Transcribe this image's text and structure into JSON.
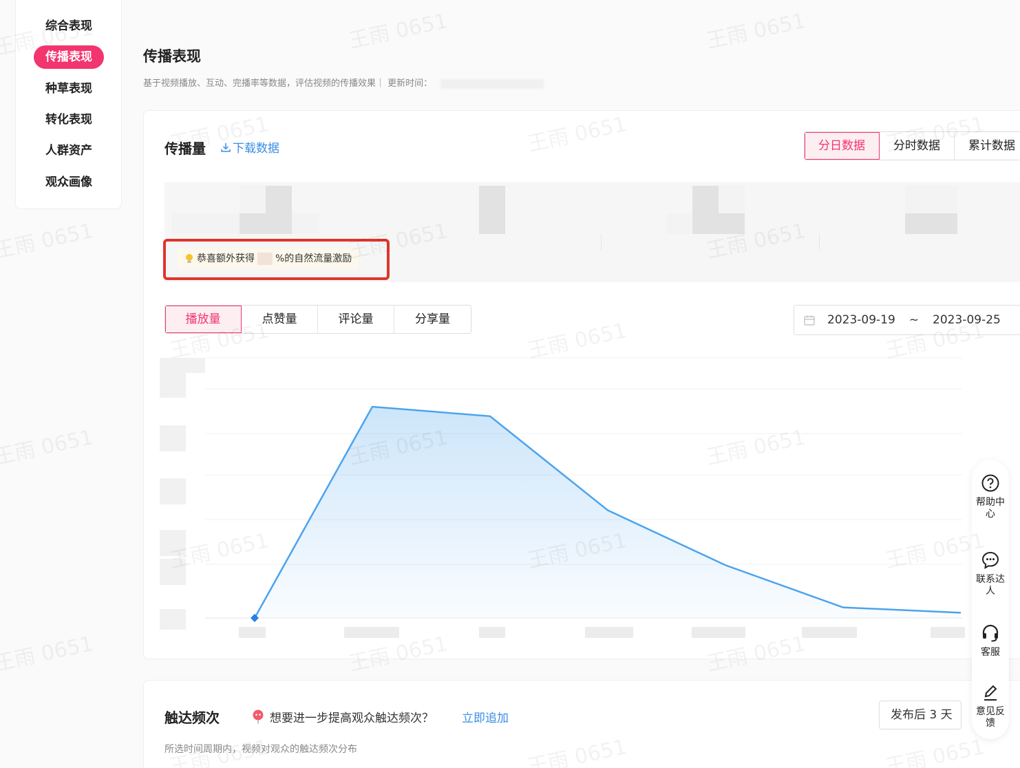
{
  "sidebar": {
    "items": [
      {
        "label": "综合表现",
        "active": false
      },
      {
        "label": "传播表现",
        "active": true
      },
      {
        "label": "种草表现",
        "active": false
      },
      {
        "label": "转化表现",
        "active": false
      },
      {
        "label": "人群资产",
        "active": false
      },
      {
        "label": "观众画像",
        "active": false
      }
    ]
  },
  "header": {
    "title": "传播表现",
    "subtitle": "基于视频播放、互动、完播率等数据，评估视频的传播效果｜ 更新时间："
  },
  "spread": {
    "title": "传播量",
    "download_label": "下载数据",
    "view_tabs": [
      "分日数据",
      "分时数据",
      "累计数据"
    ],
    "active_view": "分日数据",
    "tip": {
      "prefix": "恭喜额外获得",
      "suffix": "%的自然流量激励"
    },
    "metric_tabs": [
      "播放量",
      "点赞量",
      "评论量",
      "分享量"
    ],
    "active_metric": "播放量",
    "date_start": "2023-09-19",
    "date_sep": "~",
    "date_end": "2023-09-25"
  },
  "chart_data": {
    "type": "area",
    "x": [
      "2023-09-19",
      "2023-09-20",
      "2023-09-21",
      "2023-09-22",
      "2023-09-23",
      "2023-09-24",
      "2023-09-25"
    ],
    "values": [
      0,
      1.0,
      0.955,
      0.51,
      0.25,
      0.05,
      0.025
    ],
    "values_note": "y-axis labels are obscured; values are relative to the peak",
    "series_color": "#4ba3ee"
  },
  "frequency": {
    "title": "触达频次",
    "question": "想要进一步提高观众触达频次？",
    "link": "立即追加",
    "subtitle": "所选时间周期内，视频对观众的触达频次分布",
    "select_value": "发布后 3 天"
  },
  "tools": [
    {
      "icon": "help-icon",
      "label": "帮助中心"
    },
    {
      "icon": "chat-icon",
      "label": "联系达人"
    },
    {
      "icon": "headset-icon",
      "label": "客服"
    },
    {
      "icon": "pen-icon",
      "label": "意见反馈"
    }
  ],
  "watermark": "王雨 0651",
  "colors": {
    "accent": "#f2346f",
    "link": "#3a8ee6",
    "chart": "#4ba3ee",
    "tip_border": "#e0352b"
  }
}
